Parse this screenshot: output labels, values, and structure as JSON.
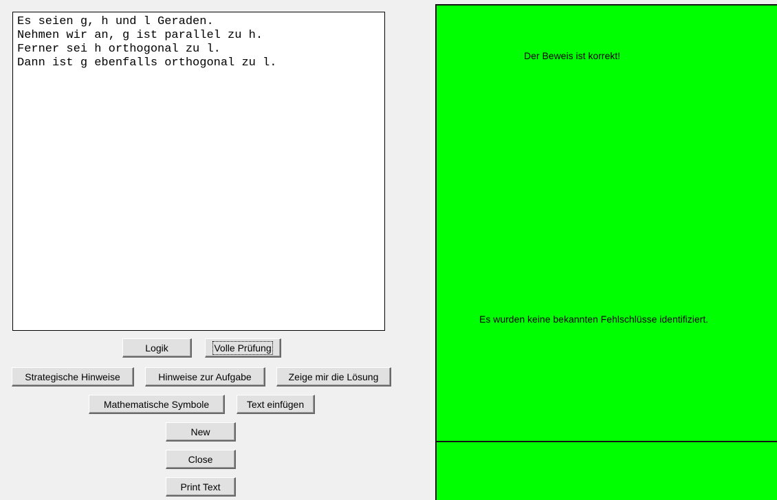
{
  "editor": {
    "lines": [
      "Es seien g, h und l Geraden.",
      "Nehmen wir an, g ist parallel zu h.",
      "Ferner sei h orthogonal zu l.",
      "Dann ist g ebenfalls orthogonal zu l."
    ]
  },
  "buttons": {
    "logik": "Logik",
    "volle_pruefung": "Volle Prüfung",
    "strategische_hinweise": "Strategische Hinweise",
    "hinweise_zur_aufgabe": "Hinweise zur Aufgabe",
    "zeige_loesung": "Zeige mir die Lösung",
    "mathematische_symbole": "Mathematische Symbole",
    "text_einfuegen": "Text einfügen",
    "new": "New",
    "close": "Close",
    "print_text": "Print Text"
  },
  "result": {
    "title": "Der Beweis ist korrekt!",
    "fallacy_message": "Es wurden keine bekannten Fehlschlüsse identifiziert.",
    "background_color": "#00ff00"
  }
}
